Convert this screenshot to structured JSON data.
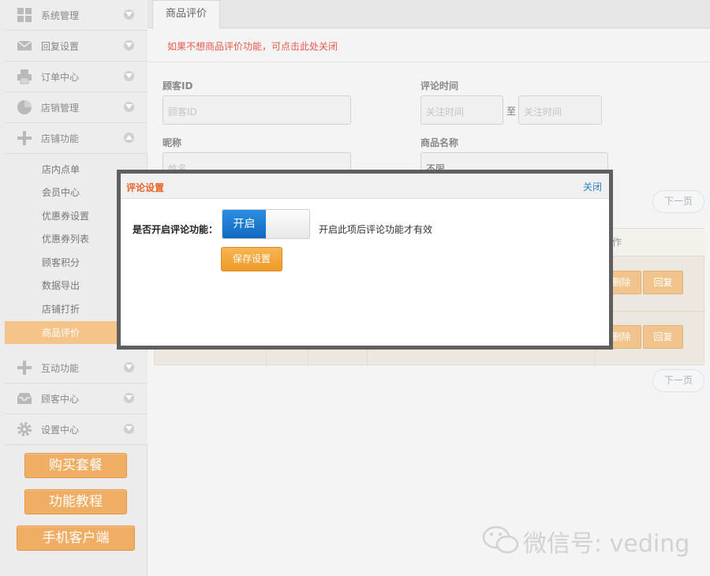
{
  "sidebar": {
    "menus": [
      {
        "label": "系统管理",
        "icon": "grid-icon"
      },
      {
        "label": "回复设置",
        "icon": "envelope-icon"
      },
      {
        "label": "订单中心",
        "icon": "printer-icon"
      },
      {
        "label": "店销管理",
        "icon": "pie-chart-icon"
      },
      {
        "label": "店铺功能",
        "icon": "plus-icon"
      }
    ],
    "sub_items": [
      "店内点单",
      "会员中心",
      "优惠券设置",
      "优惠券列表",
      "顾客积分",
      "数据导出",
      "店铺打折",
      "商品评价"
    ],
    "menus_bottom": [
      {
        "label": "互动功能",
        "icon": "plus-icon"
      },
      {
        "label": "顾客中心",
        "icon": "inbox-icon"
      },
      {
        "label": "设置中心",
        "icon": "gear-icon"
      }
    ],
    "buttons": [
      "购买套餐",
      "功能教程",
      "手机客户端"
    ]
  },
  "main": {
    "tab": "商品评价",
    "notice": "如果不想商品评价功能，可点击此处关闭",
    "filters": {
      "customer_id_label": "顾客ID",
      "customer_id_placeholder": "顾客ID",
      "nickname_label": "昵称",
      "nickname_placeholder": "姓名",
      "time_label": "评论时间",
      "time_from_placeholder": "关注时间",
      "time_sep": "至",
      "time_to_placeholder": "关注时间",
      "product_label": "商品名称",
      "product_value": "不限"
    },
    "next_page": "下一页",
    "table": {
      "header_fragment": "作",
      "rows": [
        {
          "delete_label": "删除",
          "reply_label": "回复"
        },
        {
          "delete_label": "删除",
          "reply_label": "回复"
        }
      ]
    }
  },
  "modal": {
    "title": "评论设置",
    "close": "关闭",
    "field_label": "是否开启评论功能：",
    "toggle_on": "开启",
    "hint": "开启此项后评论功能才有效",
    "save": "保存设置"
  },
  "watermark": {
    "text": "微信号: veding",
    "icon": "wechat-icon"
  },
  "colors": {
    "accent_orange": "#f0ad64",
    "notice_red": "#e75a4c",
    "toggle_blue": "#1a78d0",
    "modal_title": "#e8652c"
  }
}
